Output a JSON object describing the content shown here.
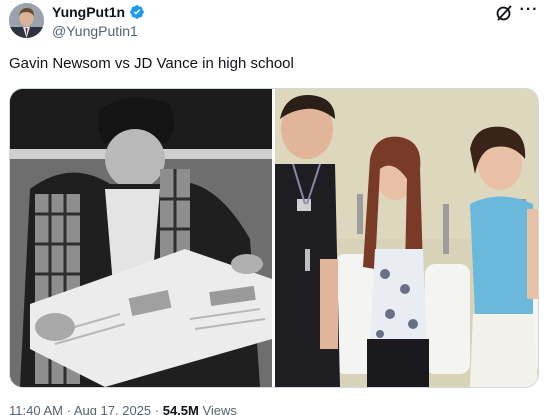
{
  "author": {
    "display_name": "YungPut1n",
    "handle": "@YungPutin1",
    "verified": true,
    "avatar_icon": "profile-photo"
  },
  "actions": {
    "grok_icon": "grok-icon",
    "more_icon": "more-options-icon",
    "more_label": "···"
  },
  "tweet": {
    "text": "Gavin Newsom vs JD Vance in high school"
  },
  "media": {
    "images": [
      {
        "description_icon": "photo-man-reading-newspaper"
      },
      {
        "description_icon": "photo-three-teens-urinals"
      }
    ]
  },
  "meta": {
    "time": "11:40 AM",
    "separator1": " · ",
    "date": "Aug 17, 2025",
    "separator2": " · ",
    "views_count": "54.5M",
    "views_label": " Views"
  },
  "colors": {
    "verified_blue": "#1d9bf0",
    "secondary_text": "#536471",
    "primary_text": "#0f1419"
  }
}
